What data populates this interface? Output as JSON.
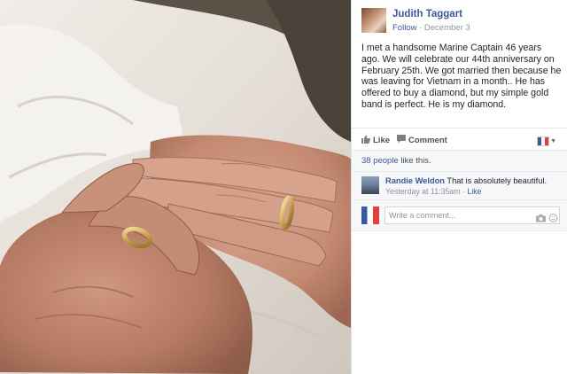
{
  "post": {
    "author_name": "Judith Taggart",
    "follow_label": "Follow",
    "separator": " · ",
    "date": "December 3",
    "text": "I met a handsome Marine Captain 46 years ago. We will celebrate our 44th anniversary on February 25th. We got married then because he was leaving for Vietnam in a month.. He has offered to buy a diamond, but my simple gold band is perfect. He is my diamond."
  },
  "actions": {
    "like_label": "Like",
    "comment_label": "Comment",
    "like_icon": "thumbs-up-icon",
    "comment_icon": "speech-bubble-icon",
    "language_icon": "france-flag-icon"
  },
  "likes": {
    "count_text": "38 people",
    "suffix": " like this."
  },
  "comment": {
    "author": "Randie Weldon",
    "text": " That is absolutely beautiful.",
    "timestamp": "Yesterday at 11:35am",
    "separator": " · ",
    "like_label": "Like"
  },
  "composer": {
    "placeholder": "Write a comment...",
    "camera_icon": "camera-icon",
    "emoji_icon": "smiley-icon"
  },
  "colors": {
    "link": "#3b5998",
    "secondary_text": "#90949c",
    "body_text": "#1d2129",
    "panel_gray": "#f6f7f9"
  }
}
